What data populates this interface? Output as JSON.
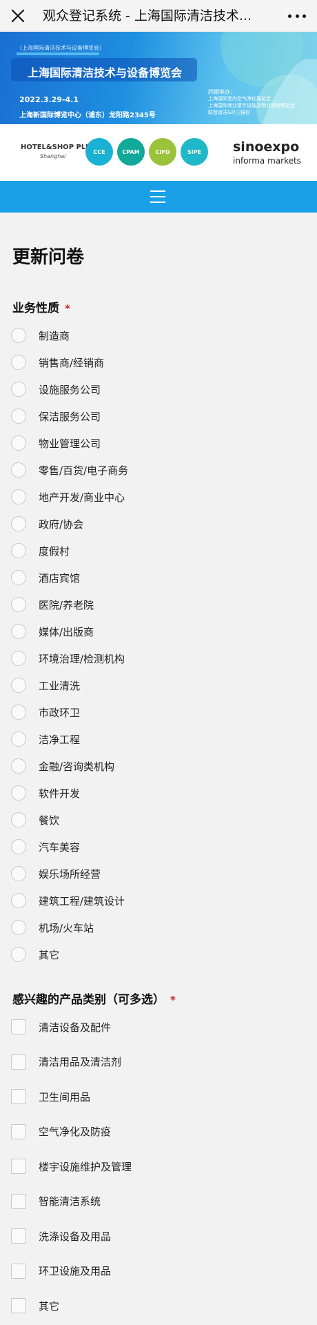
{
  "window": {
    "title": "观众登记系统 - 上海国际清洁技术..."
  },
  "banner": {
    "subtitle": "（上海国际清洁技术与设备博览会）",
    "title": "上海国际清洁技术与设备博览会",
    "date": "2022.3.29-4.1",
    "venue": "上海新国际博览中心（浦东）龙阳路2345号",
    "co_label": "同期举办：",
    "co_events": [
      "上海国际室内空气净化展览会",
      "上海国际商业楼宇设施及物业管理博览会",
      "联盟清洁&环卫展区"
    ]
  },
  "logos": {
    "hotel": "HOTEL&SHOP PLUS",
    "hotel_sub": "Shanghai",
    "circles": [
      {
        "label": "CCE",
        "color": "#1bb1d3"
      },
      {
        "label": "CPAM",
        "color": "#12a89a"
      },
      {
        "label": "CIFO",
        "color": "#9bc23b"
      },
      {
        "label": "SIPE",
        "color": "#1fb8c8"
      }
    ],
    "sinoexpo": "sinoexpo",
    "informa": "informa markets"
  },
  "page": {
    "title": "更新问卷"
  },
  "q1": {
    "label": "业务性质",
    "required": "*",
    "options": [
      "制造商",
      "销售商/经销商",
      "设施服务公司",
      "保洁服务公司",
      "物业管理公司",
      "零售/百货/电子商务",
      "地产开发/商业中心",
      "政府/协会",
      "度假村",
      "酒店宾馆",
      "医院/养老院",
      "媒体/出版商",
      "环境治理/检测机构",
      "工业清洗",
      "市政环卫",
      "洁净工程",
      "金融/咨询类机构",
      "软件开发",
      "餐饮",
      "汽车美容",
      "娱乐场所经营",
      "建筑工程/建筑设计",
      "机场/火车站",
      "其它"
    ]
  },
  "q2": {
    "label": "感兴趣的产品类别（可多选）",
    "required": "*",
    "options": [
      "清洁设备及配件",
      "清洁用品及清洁剂",
      "卫生间用品",
      "空气净化及防疫",
      "楼宇设施维护及管理",
      "智能清洁系统",
      "洗涤设备及用品",
      "环卫设施及用品",
      "其它"
    ]
  }
}
